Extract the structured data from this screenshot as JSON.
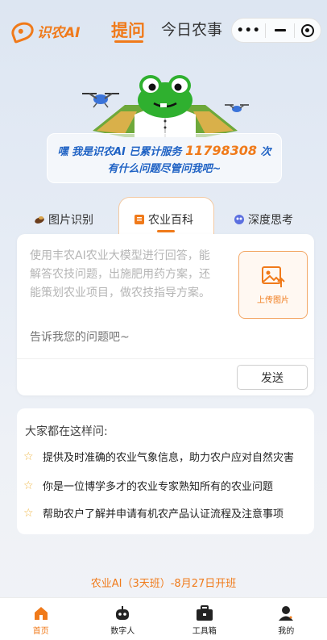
{
  "header": {
    "logo_text": "识农AI",
    "tabs": [
      {
        "label": "提问",
        "active": true
      },
      {
        "label": "今日农事",
        "active": false
      }
    ],
    "capsule": {
      "more": "•••"
    }
  },
  "greeting": {
    "prefix": "嘿 我是识农AI 已累计服务",
    "count": "11798308",
    "suffix": "次",
    "line2": "有什么问题尽管问我吧~"
  },
  "modes": [
    {
      "label": "图片识别",
      "icon": "wheat-icon",
      "active": false
    },
    {
      "label": "农业百科",
      "icon": "book-icon",
      "active": true
    },
    {
      "label": "深度思考",
      "icon": "brain-icon",
      "active": false
    }
  ],
  "ask": {
    "description": "使用丰农AI农业大模型进行回答，能解答农技问题，出施肥用药方案，还能策划农业项目，做农技指导方案。",
    "placeholder": "告诉我您的问题吧~",
    "upload_label": "上传图片",
    "send_label": "发送"
  },
  "suggestions": {
    "title": "大家都在这样问:",
    "items": [
      "提供及时准确的农业气象信息，助力农户应对自然灾害",
      "你是一位博学多才的农业专家熟知所有的农业问题",
      "帮助农户了解并申请有机农产品认证流程及注意事项"
    ]
  },
  "announcement": "农业AI（3天班）-8月27日开班",
  "bottom_nav": [
    {
      "label": "首页",
      "icon": "home-icon",
      "active": true
    },
    {
      "label": "数字人",
      "icon": "robot-icon",
      "active": false
    },
    {
      "label": "工具箱",
      "icon": "toolbox-icon",
      "active": false
    },
    {
      "label": "我的",
      "icon": "user-icon",
      "active": false
    }
  ],
  "colors": {
    "accent": "#f07a1a",
    "blue": "#1f62c4"
  }
}
